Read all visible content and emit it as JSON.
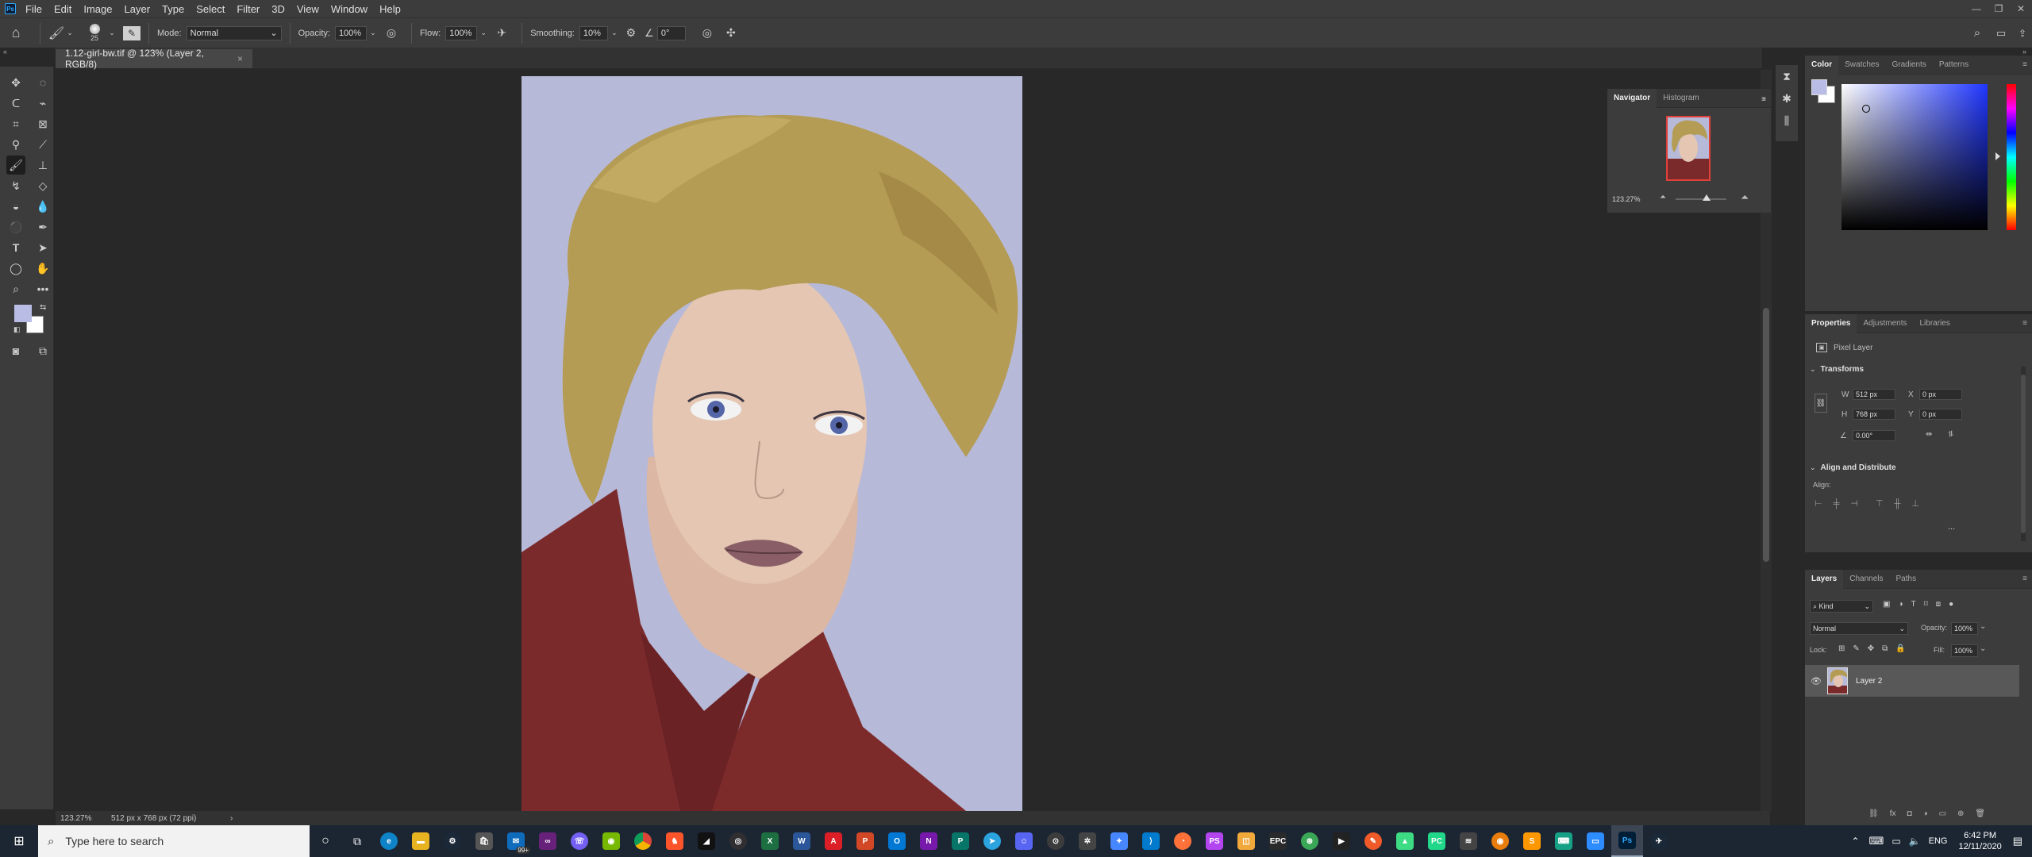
{
  "app": {
    "logo_text": "Ps"
  },
  "menu": [
    "File",
    "Edit",
    "Image",
    "Layer",
    "Type",
    "Select",
    "Filter",
    "3D",
    "View",
    "Window",
    "Help"
  ],
  "options": {
    "brush_size": "25",
    "mode_label": "Mode:",
    "mode_value": "Normal",
    "opacity_label": "Opacity:",
    "opacity_value": "100%",
    "flow_label": "Flow:",
    "flow_value": "100%",
    "smoothing_label": "Smoothing:",
    "smoothing_value": "10%",
    "angle_value": "0°"
  },
  "document": {
    "tab_title": "1.12-girl-bw.tif @ 123% (Layer 2, RGB/8)",
    "close_glyph": "×"
  },
  "status": {
    "zoom": "123.27%",
    "doc_info": "512 px x 768 px (72 ppi)",
    "arrow": "›"
  },
  "navigator": {
    "tabs": [
      "Navigator",
      "Histogram"
    ],
    "zoom": "123.27%"
  },
  "color_panel": {
    "tabs": [
      "Color",
      "Swatches",
      "Gradients",
      "Patterns"
    ],
    "fg_color": "#b9bde6",
    "bg_color": "#ffffff"
  },
  "properties": {
    "tabs": [
      "Properties",
      "Adjustments",
      "Libraries"
    ],
    "layer_type": "Pixel Layer",
    "transforms_title": "Transforms",
    "w_label": "W",
    "w_value": "512 px",
    "h_label": "H",
    "h_value": "768 px",
    "x_label": "X",
    "x_value": "0 px",
    "y_label": "Y",
    "y_value": "0 px",
    "angle_value": "0.00°",
    "align_title": "Align and Distribute",
    "align_label": "Align:",
    "more": "..."
  },
  "layers": {
    "tabs": [
      "Layers",
      "Channels",
      "Paths"
    ],
    "filter_value": "Kind",
    "blend_mode": "Normal",
    "opacity_label": "Opacity:",
    "opacity_value": "100%",
    "lock_label": "Lock:",
    "fill_label": "Fill:",
    "fill_value": "100%",
    "items": [
      {
        "name": "Layer 2"
      }
    ]
  },
  "taskbar": {
    "search_placeholder": "Type here to search",
    "badge": "99+",
    "lang": "ENG",
    "time": "6:42 PM",
    "date": "12/11/2020"
  },
  "colors": {
    "accent": "#31a8ff",
    "background_canvas": "#b7b9d8",
    "hair": "#b49d55",
    "shirt": "#7d2a2a",
    "skin": "#e3c3b0"
  }
}
